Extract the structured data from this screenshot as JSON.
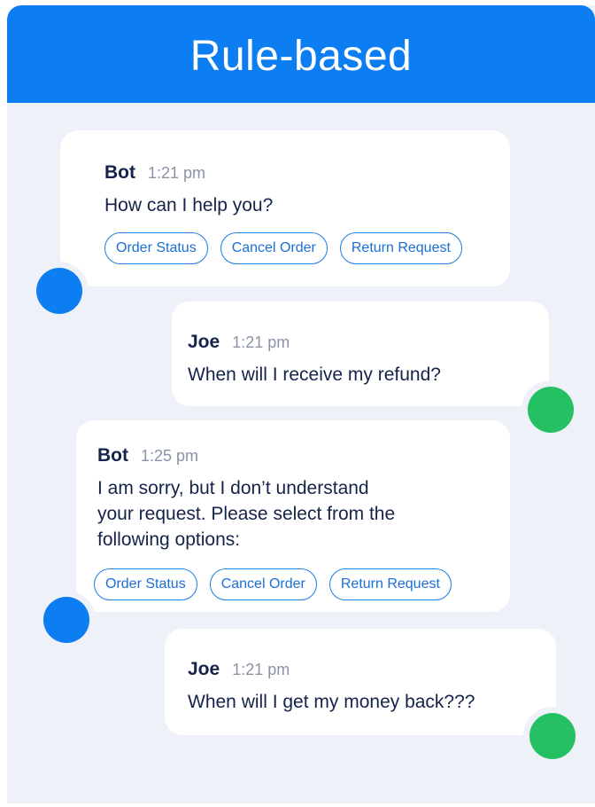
{
  "header": {
    "title": "Rule-based"
  },
  "messages": [
    {
      "sender": "Bot",
      "time": "1:21 pm",
      "text": "How can I help you?",
      "options": [
        "Order Status",
        "Cancel Order",
        "Return Request"
      ]
    },
    {
      "sender": "Joe",
      "time": "1:21 pm",
      "text": "When will I receive my refund?"
    },
    {
      "sender": "Bot",
      "time": "1:25 pm",
      "text_lines": [
        "I am sorry, but I don’t understand",
        "your request. Please select from the",
        "following options:"
      ],
      "options": [
        "Order Status",
        "Cancel Order",
        "Return Request"
      ]
    },
    {
      "sender": "Joe",
      "time": "1:21 pm",
      "text": "When will I get my money back???"
    }
  ],
  "colors": {
    "header": "#0d7ef2",
    "background": "#eef1f7",
    "bot_avatar": "#0d7ef2",
    "user_avatar": "#25c063",
    "chip_border": "#1a7de6"
  }
}
